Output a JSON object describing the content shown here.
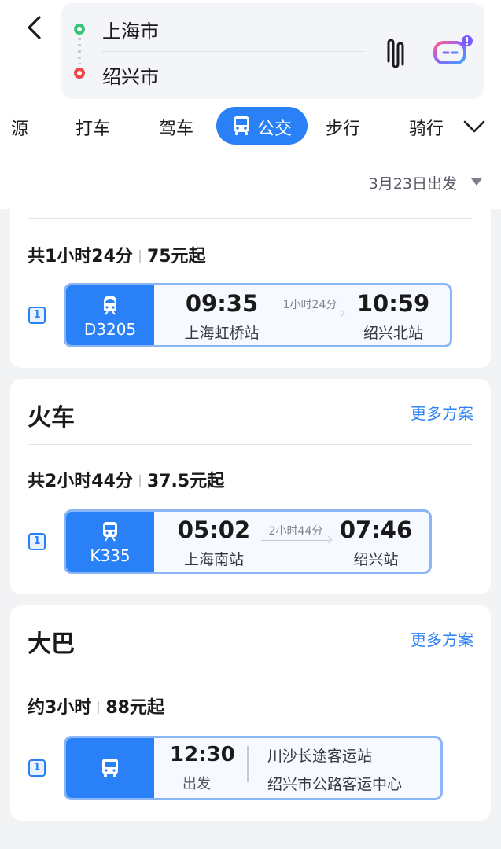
{
  "route": {
    "from": "上海市",
    "to": "绍兴市"
  },
  "tabs": {
    "t0": "源",
    "t1": "打车",
    "t2": "驾车",
    "active": "公交",
    "t4": "步行",
    "t5": "骑行"
  },
  "date": {
    "label": "3月23日出发"
  },
  "colors": {
    "accent": "#2a80f6",
    "origin": "#3cc27a",
    "destination": "#f2454a"
  },
  "high_speed": {
    "summary_total": "共1小时24分",
    "summary_price": "75元起",
    "index": "1",
    "code": "D3205",
    "depart_time": "09:35",
    "depart_station": "上海虹桥站",
    "duration": "1小时24分",
    "arrive_time": "10:59",
    "arrive_station": "绍兴北站"
  },
  "train": {
    "title": "火车",
    "more": "更多方案",
    "summary_total": "共2小时44分",
    "summary_price": "37.5元起",
    "index": "1",
    "code": "K335",
    "depart_time": "05:02",
    "depart_station": "上海南站",
    "duration": "2小时44分",
    "arrive_time": "07:46",
    "arrive_station": "绍兴站"
  },
  "bus": {
    "title": "大巴",
    "more": "更多方案",
    "summary_total": "约3小时",
    "summary_price": "88元起",
    "index": "1",
    "depart_time": "12:30",
    "depart_label": "出发",
    "from_station": "川沙长途客运站",
    "to_station": "绍兴市公路客运中心"
  }
}
